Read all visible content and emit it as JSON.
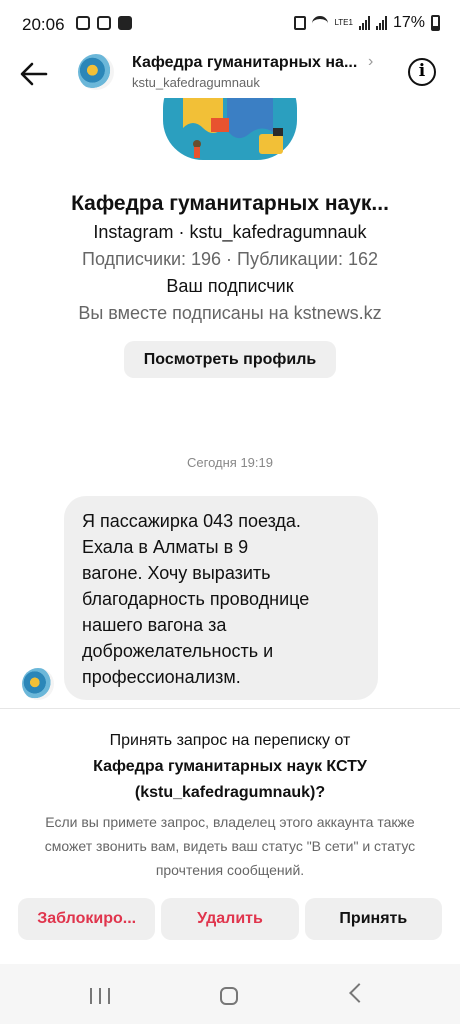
{
  "status_bar": {
    "time": "20:06",
    "battery": "17%",
    "network": "LTE1"
  },
  "header": {
    "title": "Кафедра гуманитарных на...",
    "username": "kstu_kafedragumnauk",
    "back_icon": "arrow-left-icon",
    "info_icon": "info-icon",
    "info_glyph": "i",
    "chevron_glyph": "›"
  },
  "profile": {
    "name": "Кафедра гуманитарных наук...",
    "platform_line": "Instagram · kstu_kafedragumnauk",
    "stats_line": "Подписчики: 196 · Публикации: 162",
    "follow_status": "Ваш подписчик",
    "mutual_line": "Вы вместе подписаны на kstnews.kz",
    "view_profile_label": "Посмотреть профиль"
  },
  "conversation": {
    "timestamp": "Сегодня 19:19",
    "message_lines": [
      "Я пассажирка 043  поезда.",
      "Ехала в Алматы в 9",
      "вагоне. Хочу выразить",
      "благодарность  проводнице",
      "нашего вагона  за",
      "доброжелательность и",
      "профессионализм."
    ]
  },
  "request": {
    "line1": "Принять запрос на переписку от",
    "line2": "Кафедра гуманитарных наук КСТУ",
    "line3": "(kstu_kafedragumnauk)?",
    "description": "Если вы примете запрос, владелец этого аккаунта также сможет звонить вам, видеть ваш статус \"В сети\" и статус прочтения сообщений.",
    "block_label": "Заблокиро...",
    "delete_label": "Удалить",
    "accept_label": "Принять"
  },
  "colors": {
    "danger": "#e0354d",
    "button_bg": "#efefef",
    "secondary_text": "#666666"
  }
}
